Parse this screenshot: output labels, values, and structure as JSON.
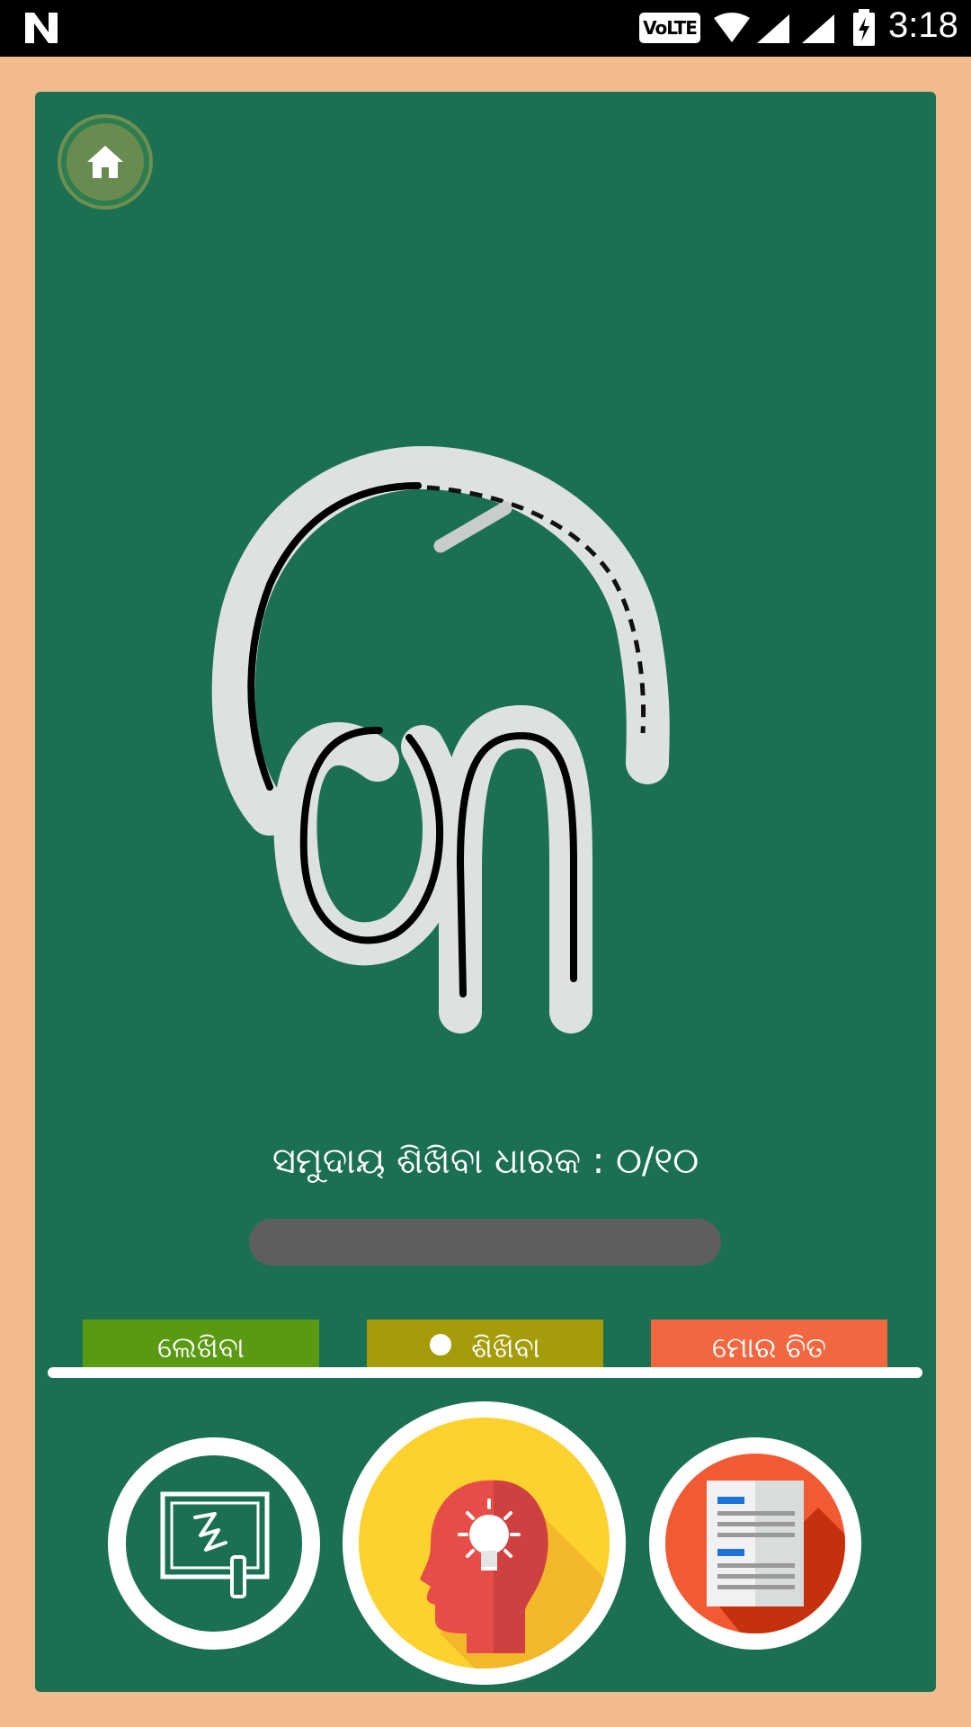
{
  "status_bar": {
    "time": "3:18",
    "network_badge": "VoLTE",
    "icons": [
      "n-logo-icon",
      "wifi-icon",
      "cell-signal-icon",
      "cell-signal-icon",
      "battery-charging-icon"
    ]
  },
  "trace": {
    "letter_icon": "odia-letter-trace"
  },
  "score": {
    "label": "ସମୁଦାୟ ଶିଖିବା ଧାରକ : ୦/୧୦",
    "progress_fraction": 0
  },
  "tabs": [
    {
      "label": "ଲେଖିବା",
      "selected": false
    },
    {
      "label": "ଶିଖିବା",
      "selected": true
    },
    {
      "label": "ମୋର ଚିତ",
      "selected": false
    }
  ],
  "buttons": {
    "home_icon": "home-icon",
    "write_icon": "whiteboard-icon",
    "learn_icon": "idea-head-icon",
    "pics_icon": "book-icon"
  },
  "colors": {
    "board": "#1c7052",
    "frame": "#f2bb8d",
    "tab_write": "#5a9a12",
    "tab_learn": "#a49c08",
    "tab_pics": "#f26740"
  }
}
